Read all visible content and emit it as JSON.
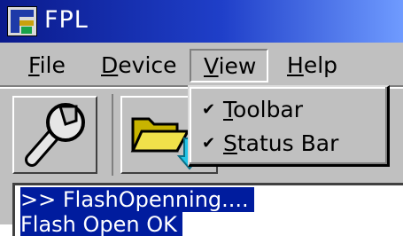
{
  "window": {
    "title": "FPL"
  },
  "menubar": {
    "file": {
      "first": "F",
      "rest": "ile"
    },
    "device": {
      "first": "D",
      "rest": "evice"
    },
    "view": {
      "first": "V",
      "rest": "iew"
    },
    "help": {
      "first": "H",
      "rest": "elp"
    }
  },
  "view_menu": {
    "items": [
      {
        "check": "✔",
        "first": "T",
        "rest": "oolbar"
      },
      {
        "check": "✔",
        "first": "S",
        "rest": "tatus Bar"
      }
    ]
  },
  "toolbar": {
    "buttons": [
      {
        "icon": "wrench-icon"
      },
      {
        "icon": "open-folder-icon"
      }
    ]
  },
  "output": {
    "lines": [
      ">> FlashOpenning....",
      "Flash Open OK"
    ]
  },
  "colors": {
    "title_gradient_start": "#0a1a8c",
    "title_gradient_end": "#6f9bff",
    "selection": "#001c9e",
    "chrome": "#c0c0c0"
  }
}
